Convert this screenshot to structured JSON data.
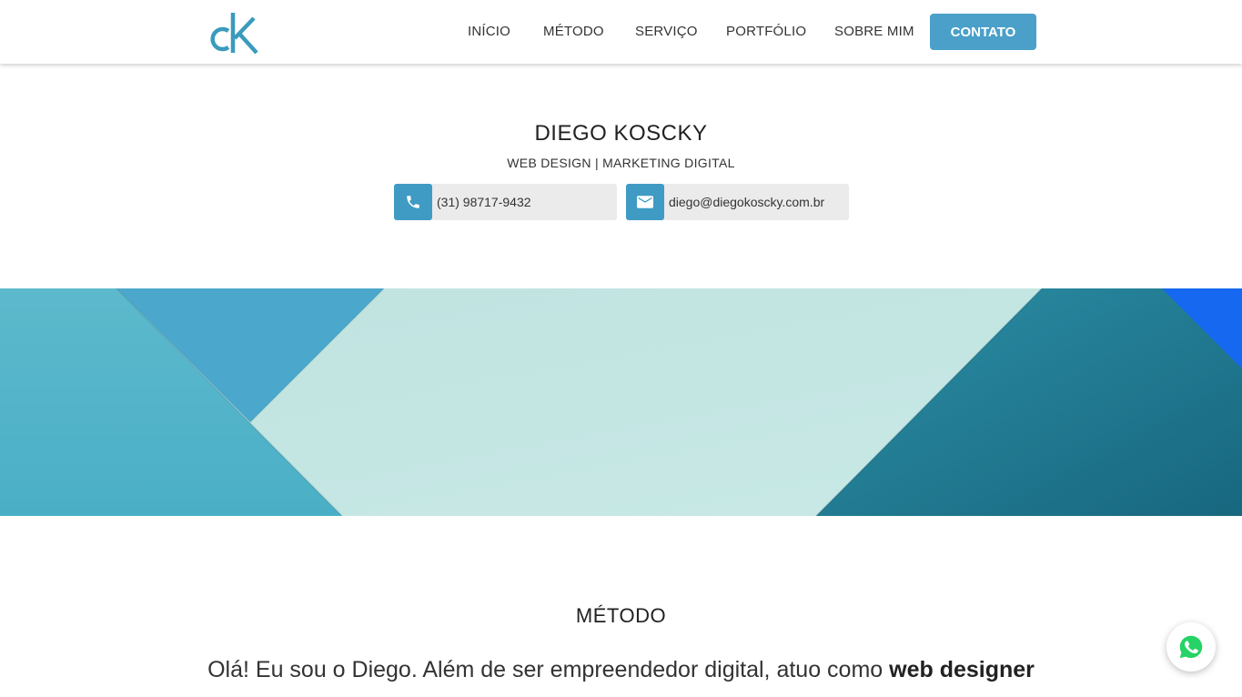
{
  "brand": {
    "logo_text": "ck",
    "accent_color": "#4aa0c8"
  },
  "nav": {
    "items": [
      {
        "label": "INÍCIO"
      },
      {
        "label": "MÉTODO"
      },
      {
        "label": "SERVIÇO"
      },
      {
        "label": "PORTFÓLIO"
      },
      {
        "label": "SOBRE MIM"
      }
    ],
    "cta_label": "CONTATO"
  },
  "intro": {
    "name": "DIEGO KOSCKY",
    "tagline": "WEB DESIGN | MARKETING DIGITAL",
    "phone": {
      "icon": "phone-icon",
      "text": "(31) 98717-9432"
    },
    "email": {
      "icon": "email-icon",
      "text": "diego@diegokoscky.com.br"
    }
  },
  "method": {
    "title": "MÉTODO",
    "text_prefix": "Olá! Eu sou o Diego. Além de ser empreendedor digital, atuo como ",
    "text_bold": "web designer"
  },
  "whatsapp": {
    "icon": "whatsapp-icon",
    "color": "#25d366"
  }
}
